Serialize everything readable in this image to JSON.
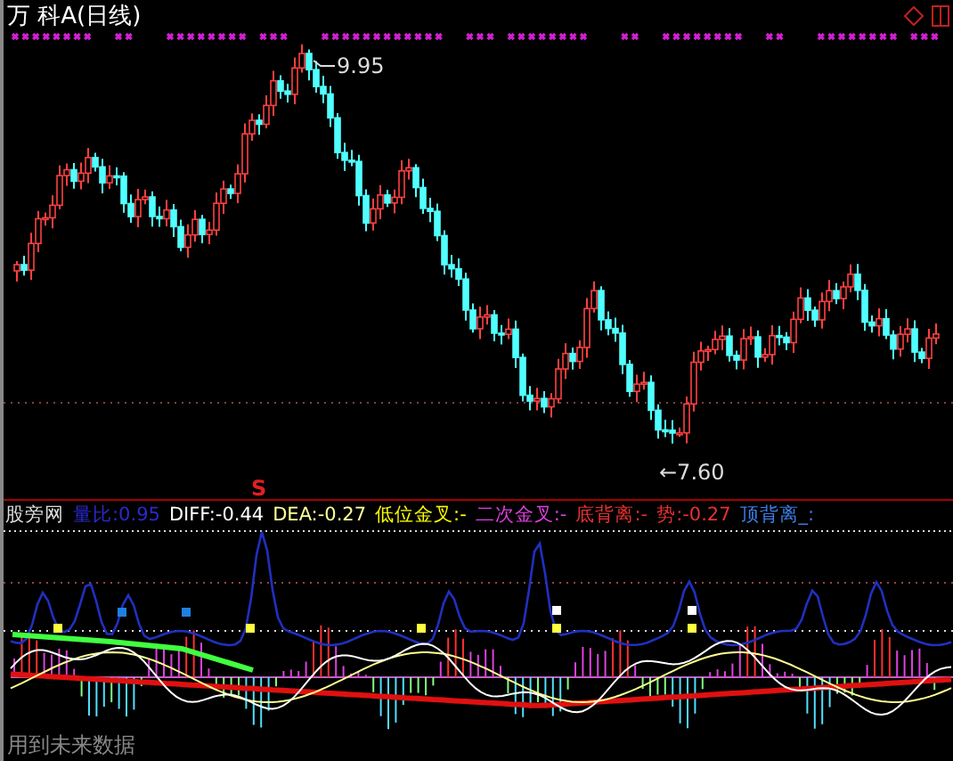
{
  "title": "万 科A(日线)",
  "main_chart": {
    "high_label": "9.95",
    "low_label": "←7.60",
    "signal_mark": "S"
  },
  "indicator": {
    "name": "股旁网",
    "items": [
      {
        "label": "量比:",
        "value": "0.95",
        "color": "#2a2ad0"
      },
      {
        "label": "DIFF:",
        "value": "-0.44",
        "color": "#ffffff"
      },
      {
        "label": "DEA:",
        "value": "-0.27",
        "color": "#ffff99"
      },
      {
        "label": "低位金叉:",
        "value": "-",
        "color": "#ffff00"
      },
      {
        "label": "二次金叉:",
        "value": "-",
        "color": "#e040e0"
      },
      {
        "label": "底背离:",
        "value": "-",
        "color": "#e83030"
      },
      {
        "label": "势:",
        "value": "-0.27",
        "color": "#e83030"
      },
      {
        "label": "顶背离_:",
        "color": "#3a7ee8"
      }
    ]
  },
  "warning": "用到未来数据"
}
